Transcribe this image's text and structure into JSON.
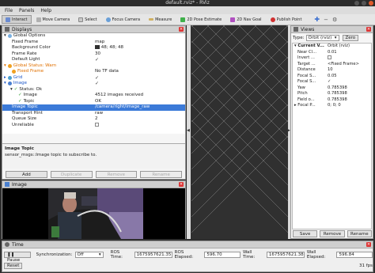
{
  "window": {
    "title": "default.rviz* - RViz"
  },
  "menu": [
    "File",
    "Panels",
    "Help"
  ],
  "toolbar": [
    {
      "label": "Interact",
      "icon": "interact-icon",
      "color": "#6a8bd1"
    },
    {
      "label": "Move Camera",
      "icon": "move-camera-icon",
      "color": "#b0b0b0"
    },
    {
      "label": "Select",
      "icon": "select-icon",
      "color": "#c8c8c8"
    },
    {
      "label": "Focus Camera",
      "icon": "focus-camera-icon",
      "color": "#6aa0d8"
    },
    {
      "label": "Measure",
      "icon": "measure-icon",
      "color": "#d0b060"
    },
    {
      "label": "2D Pose Estimate",
      "icon": "pose-estimate-icon",
      "color": "#3fb04a"
    },
    {
      "label": "2D Nav Goal",
      "icon": "nav-goal-icon",
      "color": "#b050c0"
    },
    {
      "label": "Publish Point",
      "icon": "publish-point-icon",
      "color": "#d03030"
    }
  ],
  "displays": {
    "title": "Displays",
    "rows": [
      {
        "key": "Global Options",
        "value": ""
      },
      {
        "key": "Fixed Frame",
        "value": "map"
      },
      {
        "key": "Background Color",
        "value": "48; 48; 48"
      },
      {
        "key": "Frame Rate",
        "value": "30"
      },
      {
        "key": "Default Light",
        "value": "✓"
      },
      {
        "key": "Global Status: Warn",
        "value": ""
      },
      {
        "key": "Fixed Frame",
        "value": "No TF data"
      },
      {
        "key": "Grid",
        "value": "✓"
      },
      {
        "key": "Image",
        "value": "✓"
      },
      {
        "key": "Status: Ok",
        "value": ""
      },
      {
        "key": "Image",
        "value": "4512 images received"
      },
      {
        "key": "Topic",
        "value": "OK"
      },
      {
        "key": "Image Topic",
        "value": "/camera/right/image_raw"
      },
      {
        "key": "Transport Hint",
        "value": "raw"
      },
      {
        "key": "Queue Size",
        "value": "2"
      },
      {
        "key": "Unreliable",
        "value": ""
      }
    ],
    "description_title": "Image Topic",
    "description": "sensor_msgs::Image topic to subscribe to.",
    "buttons": [
      "Add",
      "Duplicate",
      "Remove",
      "Rename"
    ]
  },
  "image_panel": {
    "title": "Image"
  },
  "views": {
    "title": "Views",
    "type_label": "Type:",
    "type_value": "Orbit (rviz)",
    "zero_label": "Zero",
    "rows": [
      {
        "key": "Current V...",
        "value": "Orbit (rviz)"
      },
      {
        "key": "Near Cl...",
        "value": "0.01"
      },
      {
        "key": "Invert ...",
        "value": ""
      },
      {
        "key": "Target ...",
        "value": "<Fixed Frame>"
      },
      {
        "key": "Distance",
        "value": "10"
      },
      {
        "key": "Focal S...",
        "value": "0.05"
      },
      {
        "key": "Focal S...",
        "value": "✓"
      },
      {
        "key": "Yaw",
        "value": "0.785398"
      },
      {
        "key": "Pitch",
        "value": "0.785398"
      },
      {
        "key": "Field o...",
        "value": "0.785398"
      },
      {
        "key": "Focal P...",
        "value": "0; 0; 0"
      }
    ],
    "buttons": [
      "Save",
      "Remove",
      "Rename"
    ]
  },
  "time": {
    "title": "Time",
    "pause_label": "Pause",
    "sync_label": "Synchronization:",
    "sync_value": "Off",
    "ros_time_label": "ROS Time:",
    "ros_time": "1675957621.35",
    "ros_elapsed_label": "ROS Elapsed:",
    "ros_elapsed": "596.70",
    "wall_time_label": "Wall Time:",
    "wall_time": "1675957621.38",
    "wall_elapsed_label": "Wall Elapsed:",
    "wall_elapsed": "596.84",
    "reset_label": "Reset",
    "fps": "31 fps"
  }
}
